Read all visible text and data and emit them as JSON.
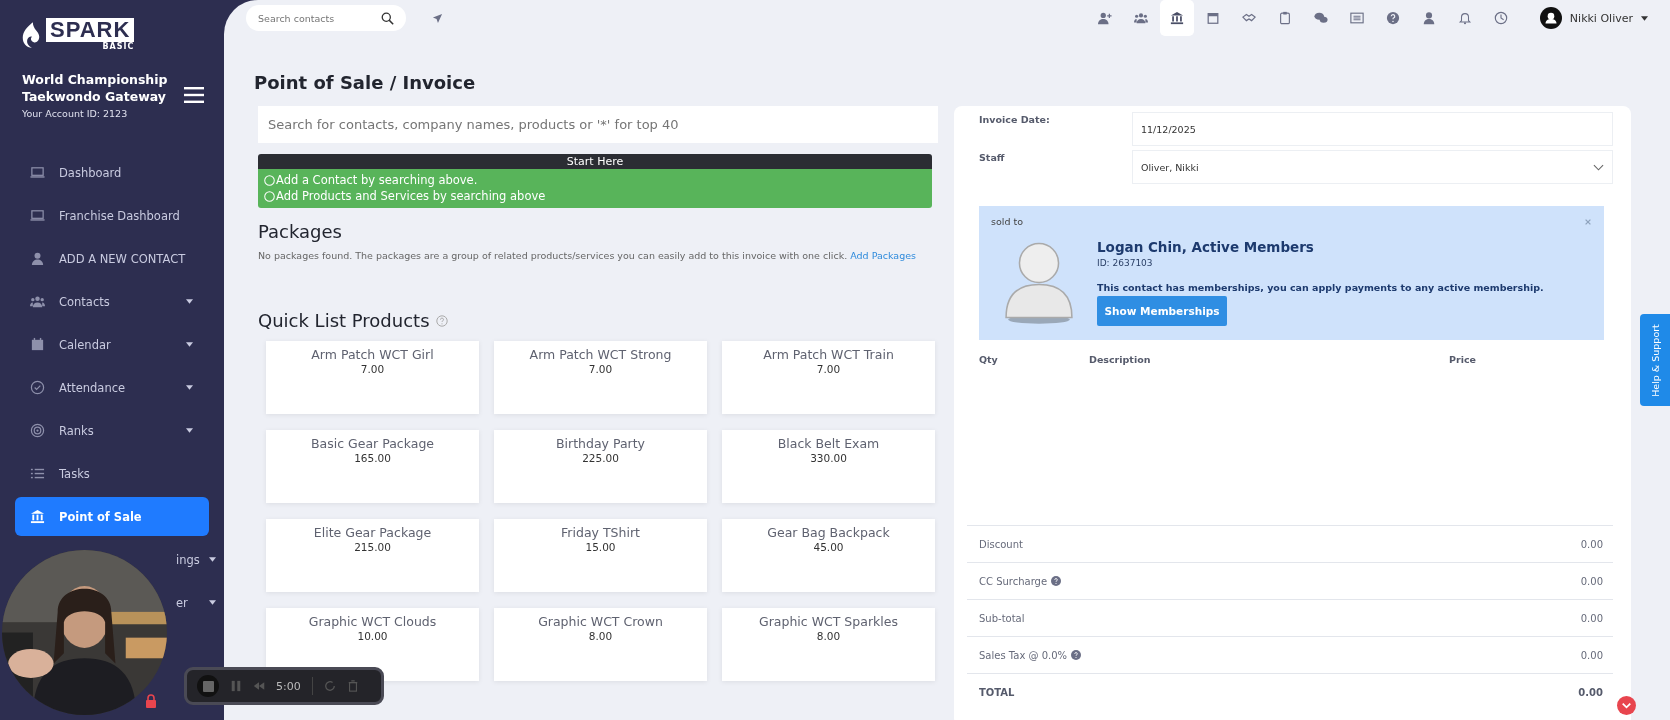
{
  "sidebar": {
    "logo": "SPARK",
    "logo_sub": "BASIC",
    "org_name": "World Championship Taekwondo Gateway",
    "account_id": "Your Account ID: 2123",
    "items": [
      {
        "label": "Dashboard",
        "expandable": false,
        "selected": false
      },
      {
        "label": "Franchise Dashboard",
        "expandable": false,
        "selected": false
      },
      {
        "label": "ADD A NEW CONTACT",
        "expandable": false,
        "selected": false
      },
      {
        "label": "Contacts",
        "expandable": true,
        "selected": false
      },
      {
        "label": "Calendar",
        "expandable": true,
        "selected": false
      },
      {
        "label": "Attendance",
        "expandable": true,
        "selected": false
      },
      {
        "label": "Ranks",
        "expandable": true,
        "selected": false
      },
      {
        "label": "Tasks",
        "expandable": false,
        "selected": false
      },
      {
        "label": "Point of Sale",
        "expandable": false,
        "selected": true
      },
      {
        "label": "ings",
        "expandable": true,
        "selected": false
      },
      {
        "label": "er",
        "expandable": true,
        "selected": false
      }
    ]
  },
  "topbar": {
    "search_placeholder": "Search contacts",
    "user_name": "Nikki Oliver",
    "icons": [
      {
        "selected": false
      },
      {
        "selected": false
      },
      {
        "selected": true
      },
      {
        "selected": false
      },
      {
        "selected": false
      },
      {
        "selected": false
      },
      {
        "selected": false
      },
      {
        "selected": false
      },
      {
        "selected": false
      },
      {
        "selected": false
      },
      {
        "selected": false
      },
      {
        "selected": false
      }
    ]
  },
  "page_title": "Point of Sale / Invoice",
  "main_search": {
    "placeholder": "Search for contacts, company names, products or '*' for top 40"
  },
  "start_here": {
    "title": "Start Here",
    "steps": [
      "Add a Contact by searching above.",
      "Add Products and Services by searching above"
    ]
  },
  "packages": {
    "title": "Packages",
    "message": "No packages found. The packages are a group of related products/services you can easily add to this invoice with one click.",
    "link": "Add Packages"
  },
  "quick_list": {
    "title": "Quick List Products",
    "products": [
      {
        "name": "Arm Patch WCT Girl",
        "price": "7.00"
      },
      {
        "name": "Arm Patch WCT Strong",
        "price": "7.00"
      },
      {
        "name": "Arm Patch WCT Train",
        "price": "7.00"
      },
      {
        "name": "Basic Gear Package",
        "price": "165.00"
      },
      {
        "name": "Birthday Party",
        "price": "225.00"
      },
      {
        "name": "Black Belt Exam",
        "price": "330.00"
      },
      {
        "name": "Elite Gear Package",
        "price": "215.00"
      },
      {
        "name": "Friday TShirt",
        "price": "15.00"
      },
      {
        "name": "Gear Bag Backpack",
        "price": "45.00"
      },
      {
        "name": "Graphic WCT Clouds",
        "price": "10.00"
      },
      {
        "name": "Graphic WCT Crown",
        "price": "8.00"
      },
      {
        "name": "Graphic WCT Sparkles",
        "price": "8.00"
      }
    ]
  },
  "invoice": {
    "date_label": "Invoice Date:",
    "date": "11/12/2025",
    "staff_label": "Staff",
    "staff": "Oliver, Nikki",
    "sold_to": {
      "label": "sold to",
      "name": "Logan Chin, Active Members",
      "id": "ID: 2637103",
      "note": "This contact has memberships, you can apply payments to any active membership.",
      "button": "Show Memberships"
    },
    "columns": [
      "Qty",
      "Description",
      "Price"
    ],
    "totals": [
      {
        "label": "Discount",
        "value": "0.00",
        "help": false,
        "kind": "line"
      },
      {
        "label": "CC Surcharge",
        "value": "0.00",
        "help": true,
        "kind": "line"
      },
      {
        "label": "Sub-total",
        "value": "0.00",
        "help": false,
        "kind": "line"
      },
      {
        "label": "Sales Tax @ 0.0%",
        "value": "0.00",
        "help": true,
        "kind": "line"
      },
      {
        "label": "TOTAL",
        "value": "0.00",
        "help": false,
        "kind": "total"
      }
    ]
  },
  "help_tab": "Help & Support",
  "recorder": {
    "time": "5:00"
  }
}
